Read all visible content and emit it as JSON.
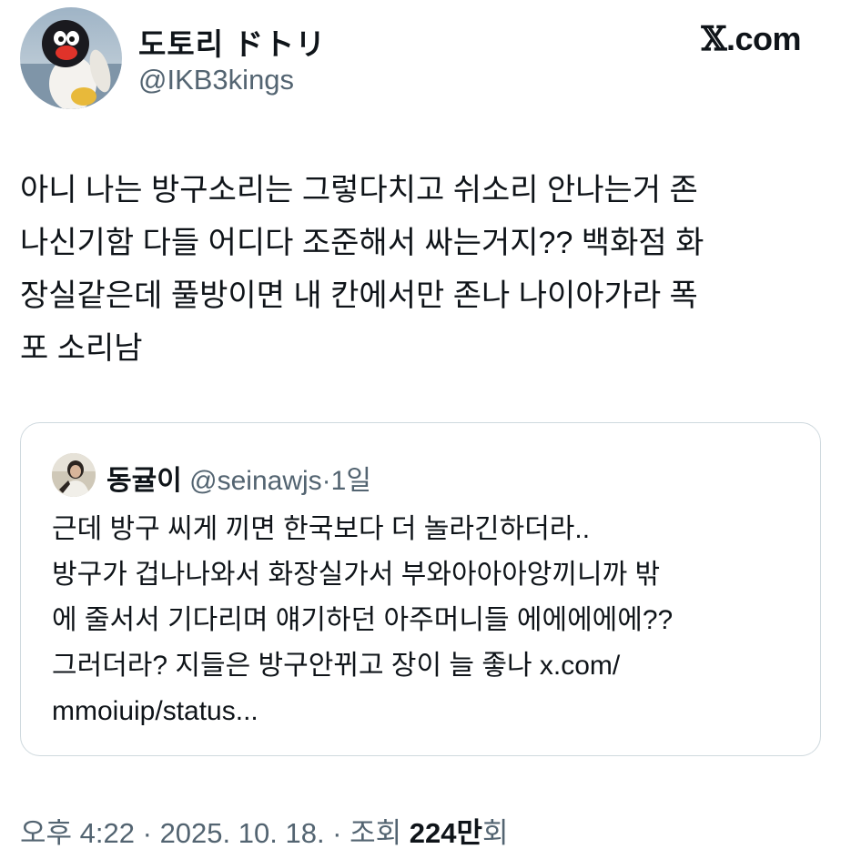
{
  "header": {
    "name": "도토리 ドトリ",
    "handle": "@IKB3kings",
    "brand_x": "𝕏",
    "brand_suffix": ".com"
  },
  "tweet": {
    "text": "아니 나는 방구소리는 그렇다치고 쉬소리 안나는거 존\n나신기함 다들 어디다 조준해서 싸는거지?? 백화점 화\n장실같은데 풀방이면 내 칸에서만 존나 나이아가라 폭\n포 소리남"
  },
  "quote": {
    "name": "동귤이",
    "handle": "@seinawjs",
    "separator": "·",
    "time": "1일",
    "text": "근데 방구 씨게 끼면 한국보다 더 놀라긴하더라..\n방구가 겁나나와서 화장실가서 부와아아아앙끼니까  밖\n에 줄서서 기다리며 얘기하던 아주머니들 에에에에에??\n그러더라? 지들은 방구안뀌고 장이 늘 좋나 x.com/\nmmoiuip/status..."
  },
  "footer": {
    "time": "오후 4:22",
    "sep1": " · ",
    "date": "2025. 10. 18.",
    "sep2": " · ",
    "views_prefix": "조회 ",
    "views_count": "224만",
    "views_suffix": "회"
  },
  "colors": {
    "text_primary": "#0f1419",
    "text_secondary": "#536471",
    "border": "#cfd9de"
  },
  "icons": {
    "avatar": "penguin-avatar",
    "quote_avatar": "person-avatar"
  }
}
